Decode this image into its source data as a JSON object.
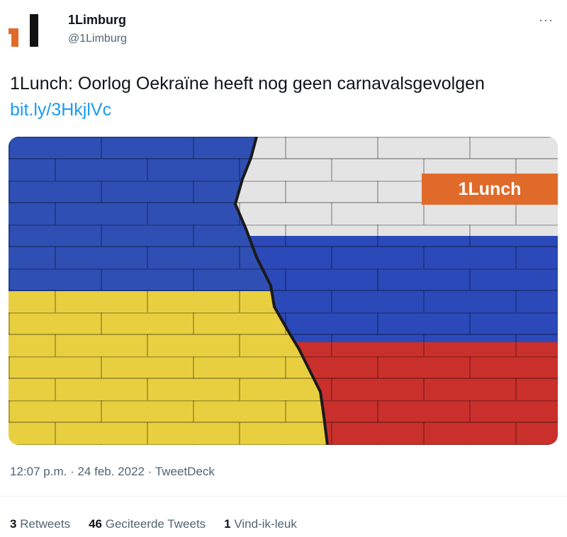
{
  "account": {
    "display_name": "1Limburg",
    "handle": "@1Limburg",
    "logo_icon": "1limburg-logo",
    "logo_color": "#e06a2a"
  },
  "menu": {
    "more_icon": "more-dots-icon",
    "glyph": "···"
  },
  "tweet": {
    "text": "1Lunch: Oorlog Oekraïne heeft nog geen carnavalsgevolgen",
    "link": "bit.ly/3HkjlVc"
  },
  "media": {
    "description_icon": "ukraine-russia-flags-wall-image",
    "badge_label": "1Lunch",
    "badge_color": "#e06a2a",
    "ukraine_colors": [
      "#2f4fb4",
      "#e8cf3f"
    ],
    "russia_colors": [
      "#e6e6e6",
      "#2b49b8",
      "#c9302c"
    ]
  },
  "meta": {
    "time": "12:07 p.m.",
    "separator": "·",
    "date": "24 feb. 2022",
    "source": "TweetDeck"
  },
  "stats": {
    "retweets_count": "3",
    "retweets_label": "Retweets",
    "quotes_count": "46",
    "quotes_label": "Geciteerde Tweets",
    "likes_count": "1",
    "likes_label": "Vind-ik-leuk"
  }
}
